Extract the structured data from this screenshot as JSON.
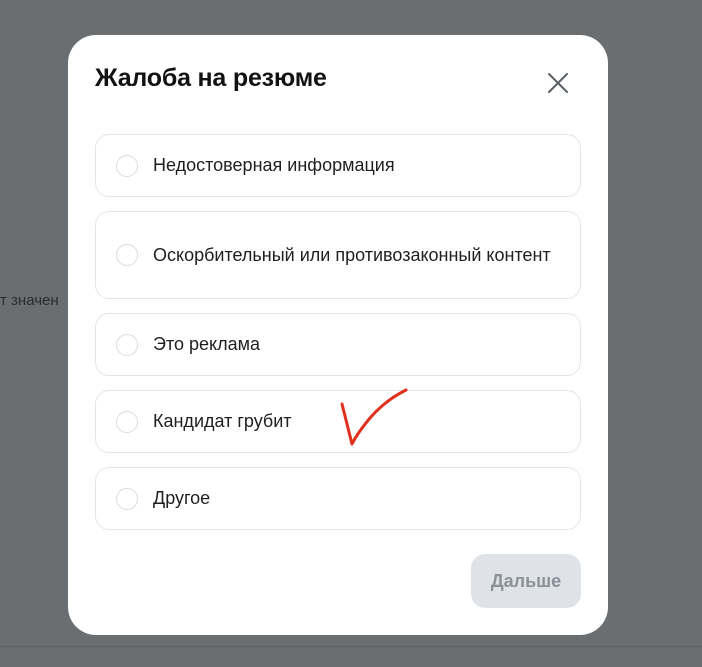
{
  "background": {
    "partial_text": "т значен"
  },
  "modal": {
    "title": "Жалоба на резюме",
    "close_icon": "close-icon",
    "options": [
      {
        "label": "Недостоверная информация",
        "selected": false
      },
      {
        "label": "Оскорбительный или противозаконный контент",
        "selected": false
      },
      {
        "label": "Это реклама",
        "selected": false
      },
      {
        "label": "Кандидат грубит",
        "selected": false
      },
      {
        "label": "Другое",
        "selected": false
      }
    ],
    "next_label": "Дальше",
    "next_enabled": false
  },
  "annotation": {
    "type": "handwritten-checkmark",
    "color": "#e0301e",
    "near_option": "Кандидат грубит"
  }
}
